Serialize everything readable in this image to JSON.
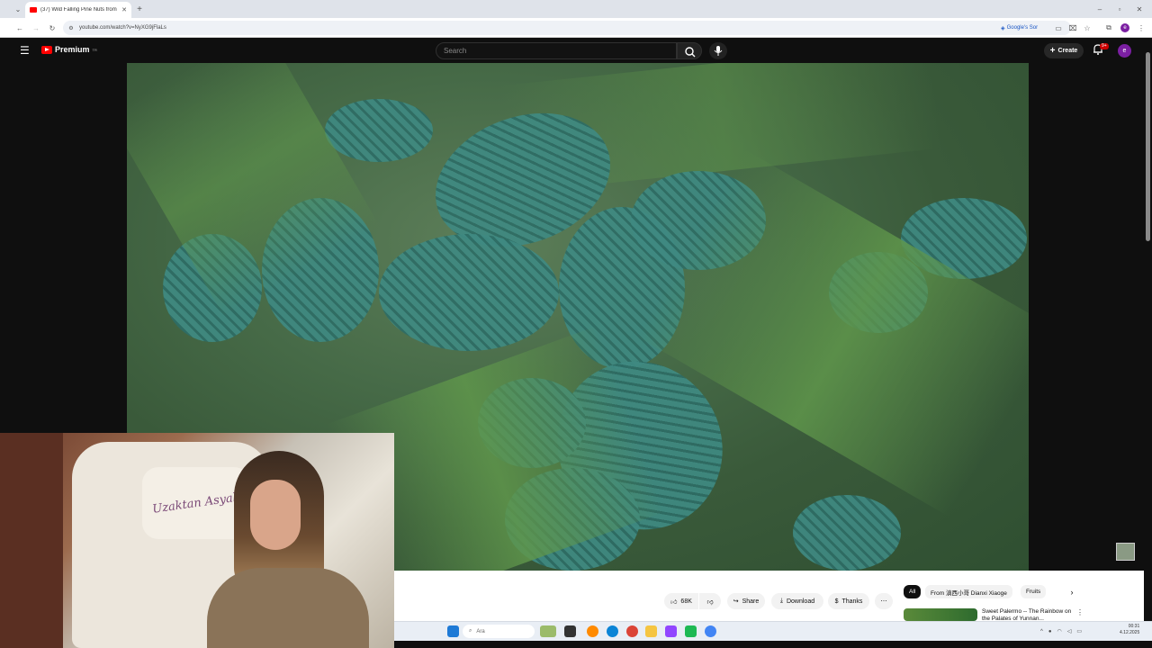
{
  "browser": {
    "tab_title": "(37) Wild Falling Pine Nuts from",
    "url": "youtube.com/watch?v=NyXG9jFlaLs",
    "translate_label": "Google's Sor",
    "profile_initial": "e"
  },
  "header": {
    "logo_text": "Premium",
    "logo_region": "TR",
    "search_placeholder": "Search",
    "create_label": "Create",
    "notification_badge": "9+",
    "avatar_initial": "e"
  },
  "webcam": {
    "pillow_text": "Uzaktan Asyalı"
  },
  "actions": {
    "like_count": "68K",
    "share_label": "Share",
    "download_label": "Download",
    "thanks_label": "Thanks"
  },
  "chips": [
    "All",
    "From 滇西小哥 Dianxi Xiaoge",
    "Fruits"
  ],
  "recommendation": {
    "title": "Sweet Palermo -- The Rainbow on the Palates of Yunnan..."
  },
  "taskbar": {
    "search_label": "Ara",
    "time": "00:31",
    "date": "4.12.2025"
  },
  "colors": {
    "youtube_red": "#ff0000",
    "header_bg": "#0f0f0f",
    "cone_teal": "#3f8a82"
  }
}
